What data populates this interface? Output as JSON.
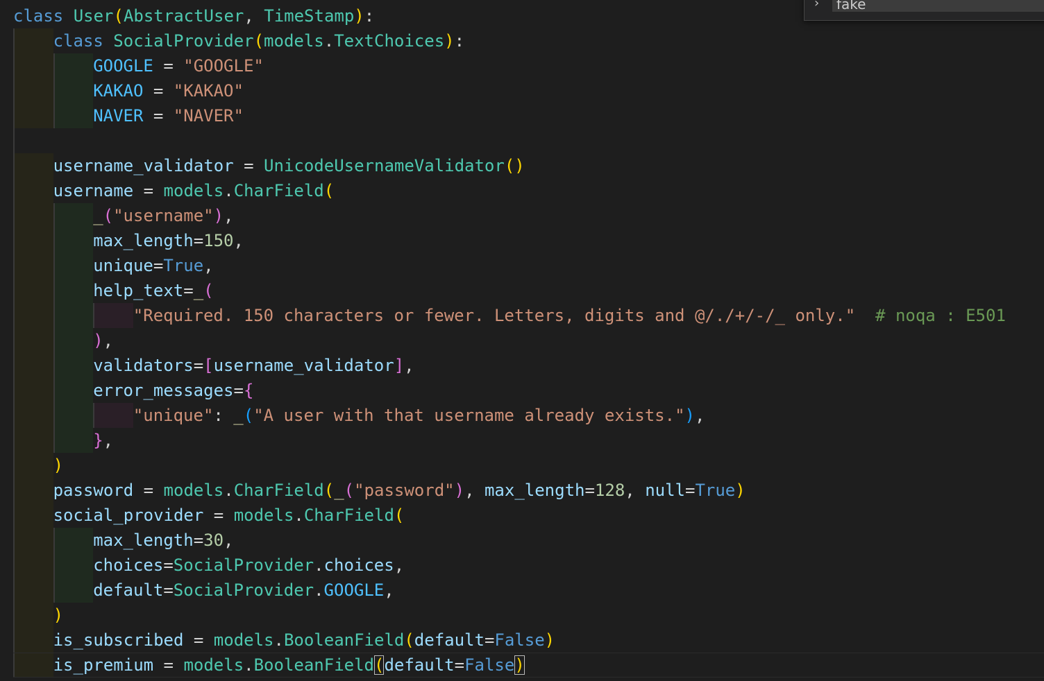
{
  "find_widget": {
    "toggle_glyph": "›",
    "query": "fake"
  },
  "code": {
    "l1": {
      "t1": "class",
      "t2": "User",
      "t3": "(",
      "t4": "AbstractUser",
      "t5": ", ",
      "t6": "TimeStamp",
      "t7": ")",
      "t8": ":"
    },
    "l2": {
      "t1": "class",
      "t2": "SocialProvider",
      "t3": "(",
      "t4": "models",
      "t5": ".",
      "t6": "TextChoices",
      "t7": ")",
      "t8": ":"
    },
    "l3": {
      "t1": "GOOGLE",
      "t2": " = ",
      "t3": "\"GOOGLE\""
    },
    "l4": {
      "t1": "KAKAO",
      "t2": " = ",
      "t3": "\"KAKAO\""
    },
    "l5": {
      "t1": "NAVER",
      "t2": " = ",
      "t3": "\"NAVER\""
    },
    "l7": {
      "t1": "username_validator",
      "t2": " = ",
      "t3": "UnicodeUsernameValidator",
      "t4": "()"
    },
    "l8": {
      "t1": "username",
      "t2": " = ",
      "t3": "models",
      "t4": ".",
      "t5": "CharField",
      "t6": "("
    },
    "l9": {
      "t1": "_",
      "t2": "(",
      "t3": "\"username\"",
      "t4": ")",
      "t5": ","
    },
    "l10": {
      "t1": "max_length",
      "t2": "=",
      "t3": "150",
      "t4": ","
    },
    "l11": {
      "t1": "unique",
      "t2": "=",
      "t3": "True",
      "t4": ","
    },
    "l12": {
      "t1": "help_text",
      "t2": "=",
      "t3": "_",
      "t4": "("
    },
    "l13": {
      "t1": "\"Required. 150 characters or fewer. Letters, digits and @/./+/-/_ only.\"",
      "t2": "  ",
      "t3": "# noqa : E501"
    },
    "l14": {
      "t1": ")",
      "t2": ","
    },
    "l15": {
      "t1": "validators",
      "t2": "=",
      "t3": "[",
      "t4": "username_validator",
      "t5": "]",
      "t6": ","
    },
    "l16": {
      "t1": "error_messages",
      "t2": "=",
      "t3": "{"
    },
    "l17": {
      "t1": "\"unique\"",
      "t2": ": ",
      "t3": "_",
      "t4": "(",
      "t5": "\"A user with that username already exists.\"",
      "t6": ")",
      "t7": ","
    },
    "l18": {
      "t1": "}",
      "t2": ","
    },
    "l19": {
      "t1": ")"
    },
    "l20": {
      "t1": "password",
      "t2": " = ",
      "t3": "models",
      "t4": ".",
      "t5": "CharField",
      "t6": "(",
      "t7": "_",
      "t8": "(",
      "t9": "\"password\"",
      "t10": ")",
      "t11": ", ",
      "t12": "max_length",
      "t13": "=",
      "t14": "128",
      "t15": ", ",
      "t16": "null",
      "t17": "=",
      "t18": "True",
      "t19": ")"
    },
    "l21": {
      "t1": "social_provider",
      "t2": " = ",
      "t3": "models",
      "t4": ".",
      "t5": "CharField",
      "t6": "("
    },
    "l22": {
      "t1": "max_length",
      "t2": "=",
      "t3": "30",
      "t4": ","
    },
    "l23": {
      "t1": "choices",
      "t2": "=",
      "t3": "SocialProvider",
      "t4": ".",
      "t5": "choices",
      "t6": ","
    },
    "l24": {
      "t1": "default",
      "t2": "=",
      "t3": "SocialProvider",
      "t4": ".",
      "t5": "GOOGLE",
      "t6": ","
    },
    "l25": {
      "t1": ")"
    },
    "l26": {
      "t1": "is_subscribed",
      "t2": " = ",
      "t3": "models",
      "t4": ".",
      "t5": "BooleanField",
      "t6": "(",
      "t7": "default",
      "t8": "=",
      "t9": "False",
      "t10": ")"
    },
    "l27": {
      "t1": "is_premium",
      "t2": " = ",
      "t3": "models",
      "t4": ".",
      "t5": "BooleanField",
      "t6": "(",
      "t7": "default",
      "t8": "=",
      "t9": "False",
      "t10": ")"
    }
  }
}
